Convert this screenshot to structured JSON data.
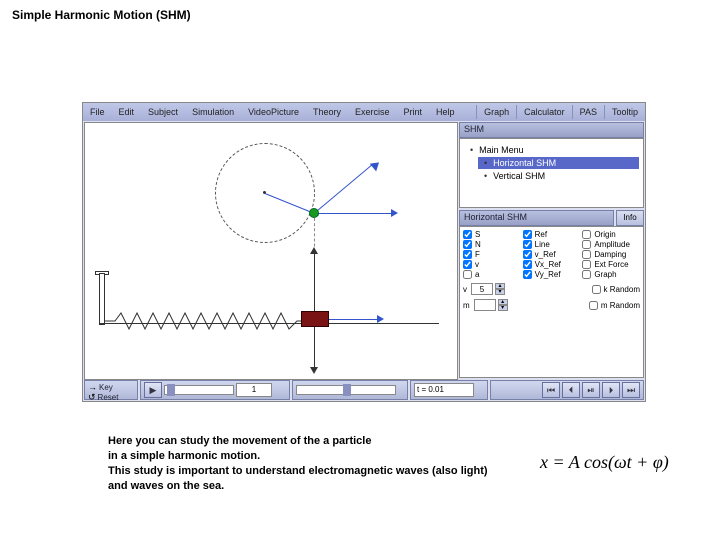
{
  "page_title": "Simple Harmonic Motion (SHM)",
  "menubar": {
    "left": [
      "File",
      "Edit",
      "Subject",
      "Simulation",
      "VideoPicture",
      "Theory",
      "Exercise",
      "Print",
      "Help"
    ],
    "right": [
      "Graph",
      "Calculator",
      "PAS",
      "Tooltip"
    ]
  },
  "nav": {
    "header": "SHM",
    "main": "Main Menu",
    "items": [
      {
        "label": "Horizontal SHM",
        "selected": true
      },
      {
        "label": "Vertical SHM",
        "selected": false
      }
    ]
  },
  "settings": {
    "header": "Horizontal SHM",
    "info": "Info",
    "checks_col1": [
      {
        "label": "S",
        "checked": true
      },
      {
        "label": "N",
        "checked": true
      },
      {
        "label": "F",
        "checked": true
      },
      {
        "label": "v",
        "checked": true
      },
      {
        "label": "a",
        "checked": false
      }
    ],
    "checks_col2": [
      {
        "label": "Ref",
        "checked": true
      },
      {
        "label": "Line",
        "checked": true
      },
      {
        "label": "v_Ref",
        "checked": true
      },
      {
        "label": "Vx_Ref",
        "checked": true
      },
      {
        "label": "Vy_Ref",
        "checked": true
      }
    ],
    "checks_col3": [
      {
        "label": "Origin",
        "checked": false
      },
      {
        "label": "Amplitude",
        "checked": false
      },
      {
        "label": "Damping",
        "checked": false
      },
      {
        "label": "Ext Force",
        "checked": false
      },
      {
        "label": "Graph",
        "checked": false
      }
    ],
    "num_controls": [
      {
        "name": "v",
        "value": "5",
        "extra": "k Random"
      },
      {
        "name": "m",
        "value": "",
        "extra": "m Random"
      }
    ]
  },
  "bottom": {
    "key_label": "Key",
    "reset_label": "Reset",
    "frame_value": "1",
    "time_label": "t = 0.01"
  },
  "caption_lines": [
    "Here you can study the movement of the a particle",
    "in a simple harmonic motion.",
    "This study is important to understand electromagnetic waves (also light)",
    "and waves on the sea."
  ],
  "formula": "x = A cos(ωt + φ)"
}
